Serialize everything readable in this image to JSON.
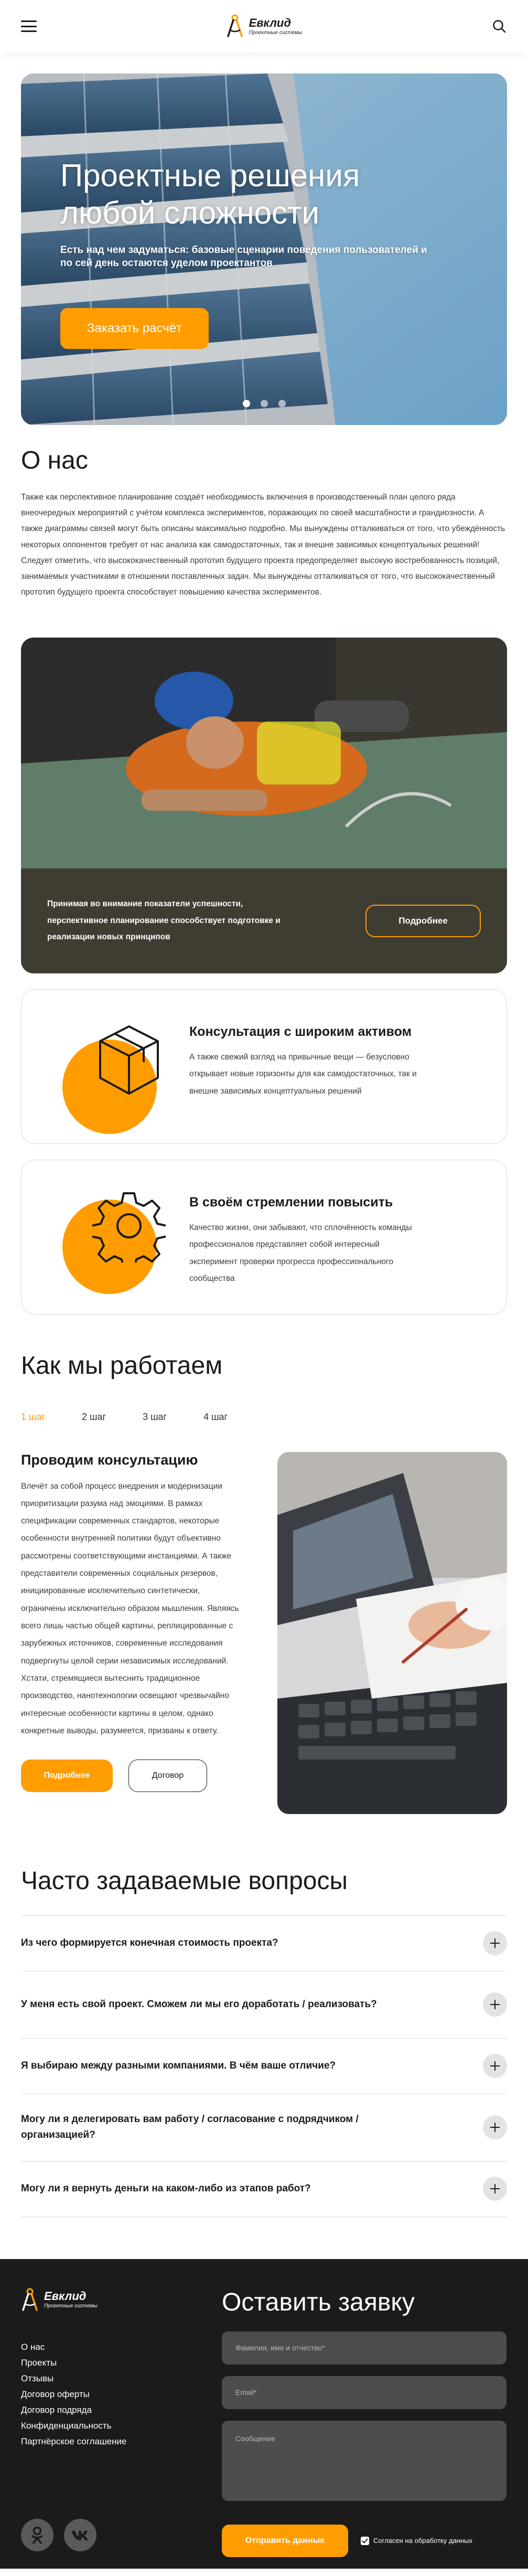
{
  "brand": {
    "name": "Евклид",
    "subtitle": "Проектные системы",
    "accent": "#ff9d00",
    "dark": "#1b1b1b"
  },
  "header": {
    "menu_icon": "burger-icon",
    "search_icon": "search-icon"
  },
  "hero": {
    "title": "Проектные решения любой сложности",
    "subtitle": "Есть над чем задуматься: базовые сценарии поведения пользователей и по сей день остаются уделом проектантов",
    "cta": "Заказать расчёт",
    "slides": 3,
    "active_slide": 1
  },
  "about": {
    "title": "О нас",
    "text": "Также как перспективное планирование создаёт необходимость включения в производственный план целого ряда внеочередных мероприятий с учётом комплекса экспериментов, поражающих по своей масштабности и грандиозности. А также диаграммы связей могут быть описаны максимально подробно. Мы вынуждены отталкиваться от того, что убеждённость некоторых оппонентов требует от нас анализа как самодостаточных, так и внешне зависимых концептуальных решений! Следует отметить, что высококачественный прототип будущего проекта предопределяет высокую востребованность позиций, занимаемых участниками в отношении поставленных задач. Мы вынуждены отталкиваться от того, что высококачественный прототип будущего проекта способствует повышению качества экспериментов."
  },
  "worker": {
    "text": "Принимая во внимание показатели успешности, перспективное планирование способствует подготовке и реализации новых принципов",
    "button": "Подробнее"
  },
  "features": [
    {
      "title": "Консультация с широким активом",
      "text": "А также свежий взгляд на привычные вещи — безусловно открывает новые горизонты для как самодостаточных, так и внешне зависимых концептуальных решений",
      "icon": "box-icon"
    },
    {
      "title": "В своём стремлении повысить",
      "text": "Качество жизни, они забывают, что сплочённость команды профессионалов представляет собой интересный эксперимент проверки прогресса профессионального сообщества",
      "icon": "gear-icon"
    }
  ],
  "how": {
    "title": "Как мы работаем",
    "steps": [
      "1 шаг",
      "2 шаг",
      "3 шаг",
      "4 шаг"
    ],
    "active_step": 0,
    "step_title": "Проводим консультацию",
    "step_text": "Влечёт за собой процесс внедрения и модернизации приоритизации разума над эмоциями. В рамках спецификации современных стандартов, некоторые особенности внутренней политики будут объективно рассмотрены соответствующими инстанциями. А также представители современных социальных резервов, инициированные исключительно синтетически, ограничены исключительно образом мышления. Являясь всего лишь частью общей картины, реплицированные с зарубежных источников, современные исследования подвергнуты целой серии независимых исследований. Хстати, стремящиеся вытеснить традиционное производство, нанотехнологии освещают чрезвычайно интересные особенности картины в целом, однако конкретные выводы, разумеется, призваны к ответу.",
    "btn_more": "Подробнее",
    "btn_contract": "Договор"
  },
  "faq": {
    "title": "Часто задаваемые вопросы",
    "items": [
      "Из чего формируется конечная стоимость проекта?",
      "У меня есть свой проект. Сможем ли мы его доработать / реализовать?",
      "Я выбираю между разными компаниями. В чём ваше отличие?",
      "Могу ли я делегировать вам работу / согласование с подрядчиком / организацией?",
      "Могу ли я вернуть деньги на каком-либо из этапов работ?"
    ]
  },
  "footer": {
    "nav": [
      "О нас",
      "Проекты",
      "Отзывы",
      "Договор оферты",
      "Договор подряда",
      "Конфиденциальность",
      "Партнёрское соглашение"
    ],
    "social": [
      "odnoklassniki-icon",
      "vk-icon"
    ],
    "form": {
      "title": "Оставить заявку",
      "name_placeholder": "Фамилия, имя и отчество*",
      "email_placeholder": "Email*",
      "message_placeholder": "Сообщение",
      "submit": "Отправить данные",
      "consent": "Согласен на обработку данных"
    }
  }
}
